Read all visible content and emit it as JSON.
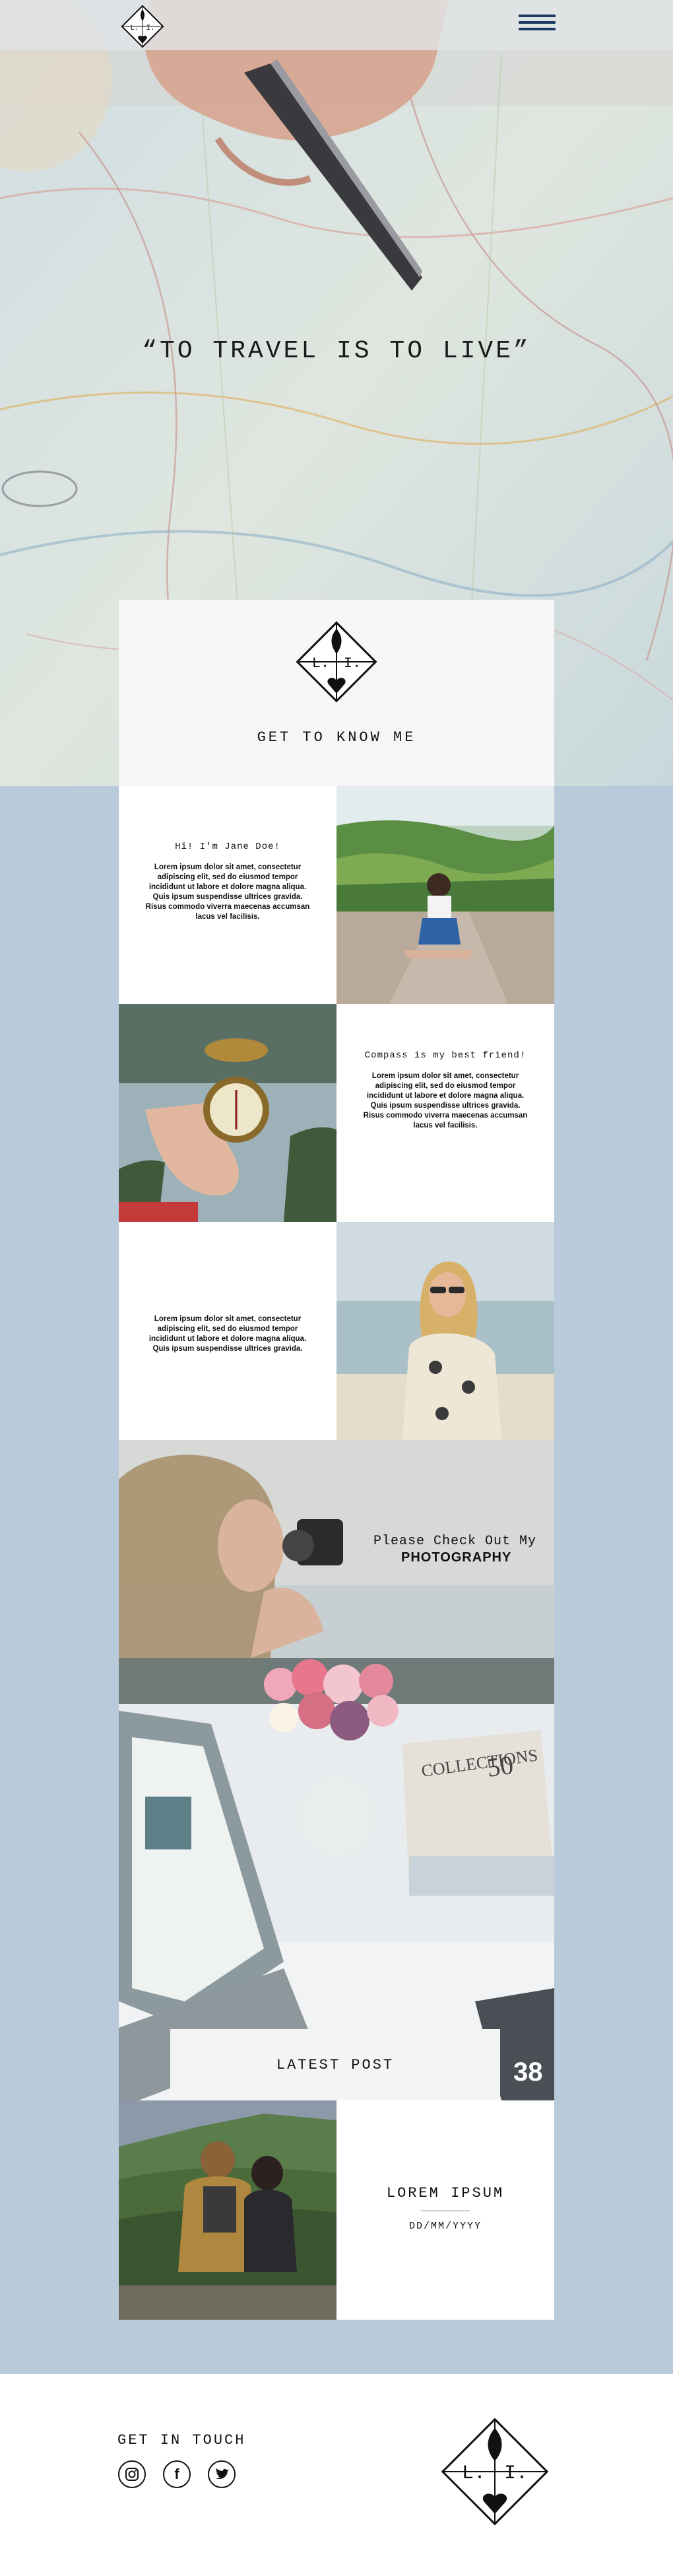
{
  "header": {
    "logo": {
      "letters": [
        "L",
        "I"
      ],
      "icon": "leaf-heart-logo-icon"
    },
    "menu_icon": "hamburger-menu-icon"
  },
  "hero": {
    "quote": "“TO TRAVEL IS TO LIVE”"
  },
  "intro": {
    "title": "GET TO KNOW ME"
  },
  "about": [
    {
      "heading": "Hi! I'm Jane Doe!",
      "body": "Lorem ipsum dolor sit amet, consectetur adipiscing elit, sed do eiusmod tempor incididunt ut labore et dolore magna aliqua. Quis ipsum suspendisse ultrices gravida. Risus commodo viverra maecenas accumsan lacus vel facilisis."
    },
    {
      "heading": "Compass is my best friend!",
      "body": "Lorem ipsum dolor sit amet, consectetur adipiscing elit, sed do eiusmod tempor incididunt ut labore et dolore magna aliqua. Quis ipsum suspendisse ultrices gravida. Risus commodo viverra maecenas accumsan lacus vel facilisis."
    },
    {
      "heading": "",
      "body": "Lorem ipsum dolor sit amet, consectetur adipiscing elit, sed do eiusmod tempor incididunt ut labore et dolore magna aliqua. Quis ipsum suspendisse ultrices gravida."
    }
  ],
  "photography": {
    "line1": "Please Check Out My",
    "line2": "PHOTOGRAPHY"
  },
  "latest": {
    "button": "LATEST POST",
    "post_title": "LOREM IPSUM",
    "post_date": "DD/MM/YYYY",
    "magazine_text": "COLLECTIONS",
    "magazine_number": "50",
    "phone_number": "38"
  },
  "footer": {
    "title": "GET IN TOUCH",
    "social_icons": [
      "instagram-icon",
      "facebook-icon",
      "twitter-icon"
    ],
    "facebook_glyph": "f"
  },
  "colors": {
    "page_bg": "#b9cadb",
    "card_bg": "#ffffff",
    "menu_accent": "#1d3b63"
  }
}
